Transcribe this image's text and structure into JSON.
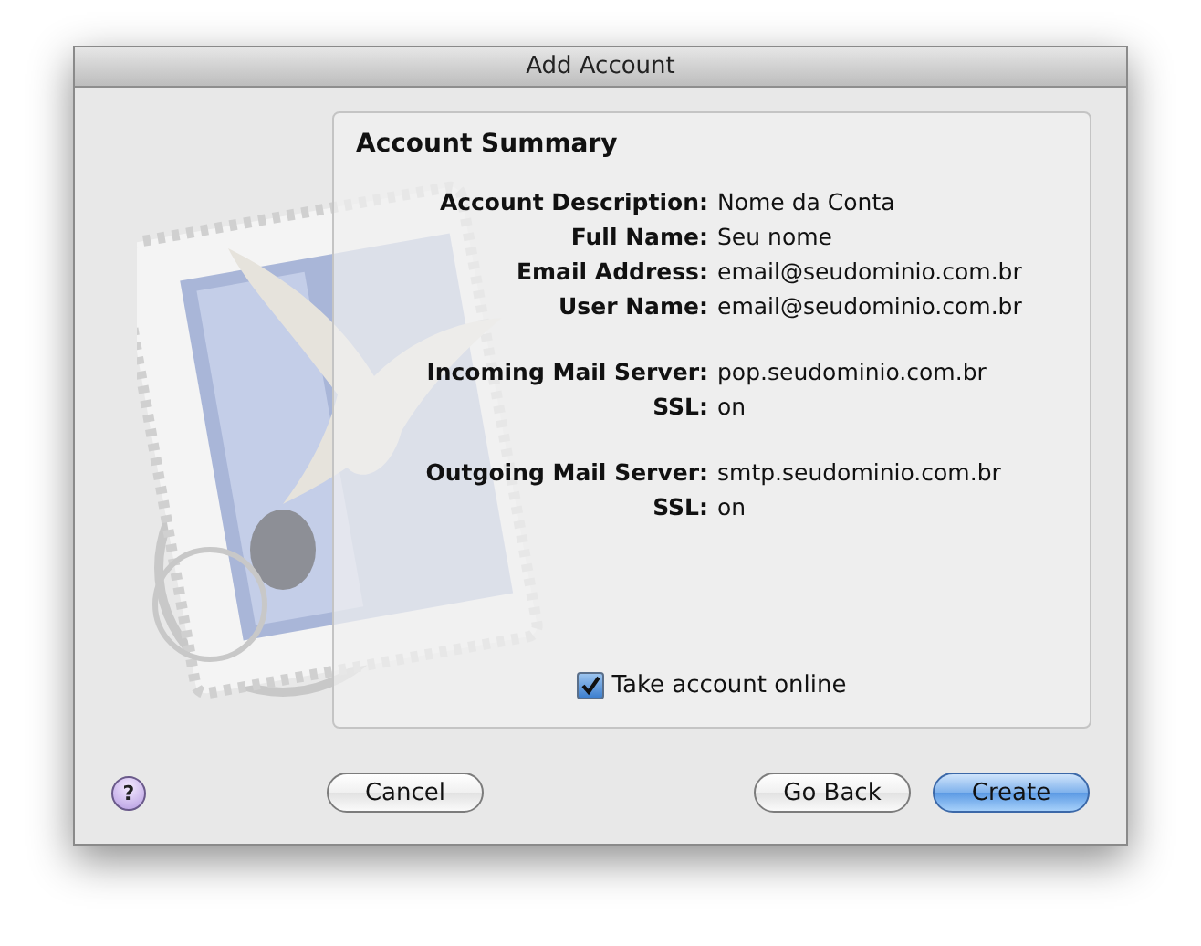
{
  "window": {
    "title": "Add Account"
  },
  "summary": {
    "title": "Account Summary",
    "groups": [
      [
        {
          "label": "Account Description:",
          "value": "Nome da Conta"
        },
        {
          "label": "Full Name:",
          "value": "Seu nome"
        },
        {
          "label": "Email Address:",
          "value": "email@seudominio.com.br"
        },
        {
          "label": "User Name:",
          "value": "email@seudominio.com.br"
        }
      ],
      [
        {
          "label": "Incoming Mail Server:",
          "value": "pop.seudominio.com.br"
        },
        {
          "label": "SSL:",
          "value": "on"
        }
      ],
      [
        {
          "label": "Outgoing Mail Server:",
          "value": "smtp.seudominio.com.br"
        },
        {
          "label": "SSL:",
          "value": "on"
        }
      ]
    ],
    "take_online": {
      "label": "Take account online",
      "checked": true
    }
  },
  "help": "?",
  "buttons": [
    {
      "label": "Cancel",
      "default": false
    },
    {
      "label": "Go Back",
      "default": false
    },
    {
      "label": "Create",
      "default": true
    }
  ]
}
